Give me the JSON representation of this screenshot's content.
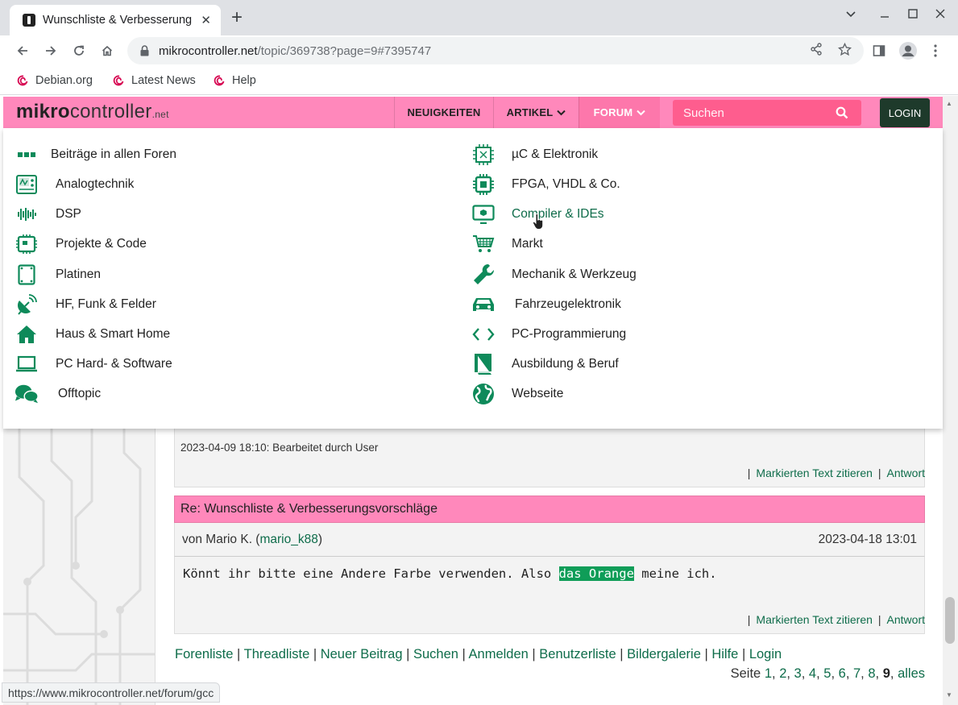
{
  "browser": {
    "tab_title": "Wunschliste & Verbesserung",
    "tab_close": "✕",
    "new_tab": "+",
    "url_host": "mikrocontroller.net",
    "url_path": "/topic/369738?page=9#7395747",
    "bookmarks": [
      {
        "label": "Debian.org"
      },
      {
        "label": "Latest News"
      },
      {
        "label": "Help"
      }
    ],
    "status_url": "https://www.mikrocontroller.net/forum/gcc"
  },
  "site": {
    "logo_bold": "mikro",
    "logo_light": "controller",
    "logo_tld": ".net",
    "nav": {
      "news": "NEUIGKEITEN",
      "articles": "ARTIKEL",
      "forum": "FORUM"
    },
    "search_placeholder": "Suchen",
    "login": "LOGIN",
    "accent_color": "#ff88bb",
    "link_color": "#0e6c4a"
  },
  "forum_menu": {
    "left": [
      {
        "label": "Beiträge in allen Foren",
        "icon": "dots-icon"
      },
      {
        "label": "Analogtechnik",
        "icon": "oscilloscope-icon"
      },
      {
        "label": "DSP",
        "icon": "waveform-icon"
      },
      {
        "label": "Projekte & Code",
        "icon": "board-icon"
      },
      {
        "label": "Platinen",
        "icon": "pcb-icon"
      },
      {
        "label": "HF, Funk & Felder",
        "icon": "satellite-dish-icon"
      },
      {
        "label": "Haus & Smart Home",
        "icon": "home-icon"
      },
      {
        "label": "PC Hard- & Software",
        "icon": "laptop-icon"
      },
      {
        "label": "Offtopic",
        "icon": "chat-bubbles-icon"
      }
    ],
    "right": [
      {
        "label": "µC & Elektronik",
        "icon": "chip-icon"
      },
      {
        "label": "FPGA, VHDL & Co.",
        "icon": "fpga-chip-icon"
      },
      {
        "label": "Compiler & IDEs",
        "icon": "monitor-icon"
      },
      {
        "label": "Markt",
        "icon": "shopping-cart-icon"
      },
      {
        "label": "Mechanik & Werkzeug",
        "icon": "wrench-icon"
      },
      {
        "label": "Fahrzeugelektronik",
        "icon": "car-icon"
      },
      {
        "label": "PC-Programmierung",
        "icon": "code-icon"
      },
      {
        "label": "Ausbildung & Beruf",
        "icon": "book-icon"
      },
      {
        "label": "Webseite",
        "icon": "globe-icon"
      }
    ]
  },
  "previous_post": {
    "edit_note": "2023-04-09 18:10: Bearbeitet durch User",
    "quote_label": "Markierten Text zitieren",
    "reply_label": "Antwort",
    "separator": "|"
  },
  "post": {
    "title": "Re: Wunschliste & Verbesserungsvorschläge",
    "by": "von Mario K. (",
    "username": "mario_k88",
    "by_close": ")",
    "date": "2023-04-18 13:01",
    "text_before": "Könnt ihr bitte eine Andere Farbe verwenden. Also ",
    "text_highlight": "das Orange",
    "text_after": " meine ich.",
    "quote_label": "Markierten Text zitieren",
    "reply_label": "Antwort",
    "separator": "|"
  },
  "footer": {
    "links": [
      "Forenliste",
      "Threadliste",
      "Neuer Beitrag",
      "Suchen",
      "Anmelden",
      "Benutzerliste",
      "Bildergalerie",
      "Hilfe",
      "Login"
    ],
    "separator": " | ",
    "pager_label": "Seite ",
    "pages": [
      "1",
      "2",
      "3",
      "4",
      "5",
      "6",
      "7",
      "8"
    ],
    "current_page": "9",
    "all_label": "alles"
  }
}
